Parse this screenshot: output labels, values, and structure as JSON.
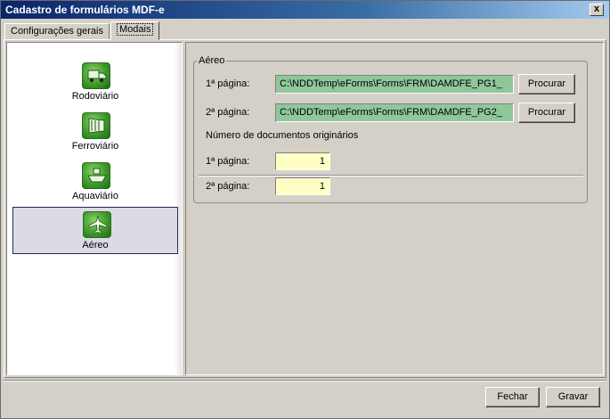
{
  "window": {
    "title": "Cadastro de formulários MDF-e",
    "close_label": "x"
  },
  "tabs": [
    {
      "label": "Configurações gerais",
      "active": false
    },
    {
      "label": "Modais",
      "active": true
    }
  ],
  "modals": [
    {
      "label": "Rodoviário",
      "icon": "truck-icon",
      "selected": false
    },
    {
      "label": "Ferroviário",
      "icon": "train-icon",
      "selected": false
    },
    {
      "label": "Aquaviário",
      "icon": "ship-icon",
      "selected": false
    },
    {
      "label": "Aéreo",
      "icon": "airplane-icon",
      "selected": true
    }
  ],
  "aereo": {
    "group_title": "Aéreo",
    "page1_label": "1ª página:",
    "page1_path": "C:\\NDDTemp\\eForms\\Forms\\FRM\\DAMDFE_PG1_",
    "page2_label": "2ª página:",
    "page2_path": "C:\\NDDTemp\\eForms\\Forms\\FRM\\DAMDFE_PG2_",
    "browse_label": "Procurar",
    "original_docs_title": "Número de documentos originários",
    "docs_page1_label": "1ª página:",
    "docs_page1_value": "1",
    "docs_page2_label": "2ª página:",
    "docs_page2_value": "1"
  },
  "footer": {
    "close_label": "Fechar",
    "save_label": "Gravar"
  },
  "colors": {
    "path_field_bg": "#8fc79a",
    "number_field_bg": "#ffffc4",
    "selection_border": "#1f2a5a"
  }
}
